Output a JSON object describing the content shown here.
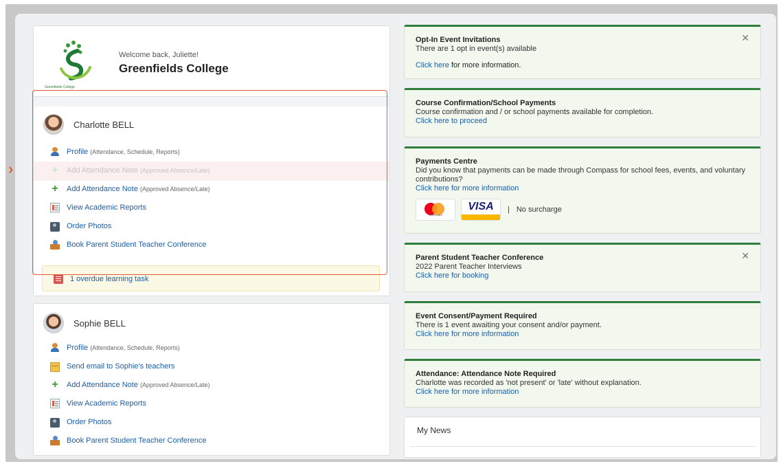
{
  "school": {
    "welcome": "Welcome back, Juliette!",
    "name": "Greenfields College",
    "logo_caption": "Greenfields College"
  },
  "students": [
    {
      "name": "Charlotte BELL",
      "links": [
        {
          "label": "Profile",
          "sub": "(Attendance, Schedule, Reports)",
          "icon": "profile-icon"
        },
        {
          "label": "Add Attendance Note",
          "sub": "(Approved Absence/Late)",
          "icon": "plus-icon"
        },
        {
          "label": "Add Attendance Note",
          "sub": "(Approved Absence/Late)",
          "icon": "plus-icon"
        },
        {
          "label": "View Academic Reports",
          "sub": "",
          "icon": "report-icon"
        },
        {
          "label": "Order Photos",
          "sub": "",
          "icon": "photo-icon"
        },
        {
          "label": "Book Parent Student Teacher Conference",
          "sub": "",
          "icon": "conference-icon"
        }
      ],
      "task": "1 overdue learning task"
    },
    {
      "name": "Sophie BELL",
      "links": [
        {
          "label": "Profile",
          "sub": "(Attendance, Schedule, Reports)",
          "icon": "profile-icon"
        },
        {
          "label": "Send email to Sophie's teachers",
          "sub": "",
          "icon": "mail-icon"
        },
        {
          "label": "Add Attendance Note",
          "sub": "(Approved Absence/Late)",
          "icon": "plus-icon"
        },
        {
          "label": "View Academic Reports",
          "sub": "",
          "icon": "report-icon"
        },
        {
          "label": "Order Photos",
          "sub": "",
          "icon": "photo-icon"
        },
        {
          "label": "Book Parent Student Teacher Conference",
          "sub": "",
          "icon": "conference-icon"
        }
      ]
    }
  ],
  "notices": [
    {
      "title": "Opt-In Event Invitations",
      "body": "There are 1 opt in event(s) available",
      "link": "Click here",
      "link_suffix": " for more information.",
      "closable": true
    },
    {
      "title": "Course Confirmation/School Payments",
      "body": "Course confirmation and / or school payments available for completion.",
      "link": "Click here to proceed",
      "link_suffix": "",
      "closable": false
    },
    {
      "title": "Payments Centre",
      "body": "Did you know that payments can be made through Compass for school fees, events, and voluntary contributions?",
      "link": "Click here for more information",
      "link_suffix": "",
      "closable": false
    },
    {
      "title": "Parent Student Teacher Conference",
      "body": "2022 Parent Teacher Interviews",
      "link": "Click here for booking",
      "link_suffix": "",
      "closable": true
    },
    {
      "title": "Event Consent/Payment Required",
      "body": "There is 1 event awaiting your consent and/or payment.",
      "link": "Click here for more information",
      "link_suffix": "",
      "closable": false
    },
    {
      "title": "Attendance: Attendance Note Required",
      "body": "Charlotte was recorded as 'not present' or 'late' without explanation.",
      "link": "Click here for more information",
      "link_suffix": "",
      "closable": false
    }
  ],
  "payments": {
    "mastercard_label": "mastercard",
    "visa_label": "VISA",
    "separator": "|",
    "surcharge": "No surcharge"
  },
  "news": {
    "title": "My News"
  },
  "icons": {
    "close": "✕",
    "arrow": "›"
  },
  "colors": {
    "accent_green": "#2e7d3a",
    "link_blue": "#1b5ea8",
    "highlight": "#e05a3a"
  }
}
